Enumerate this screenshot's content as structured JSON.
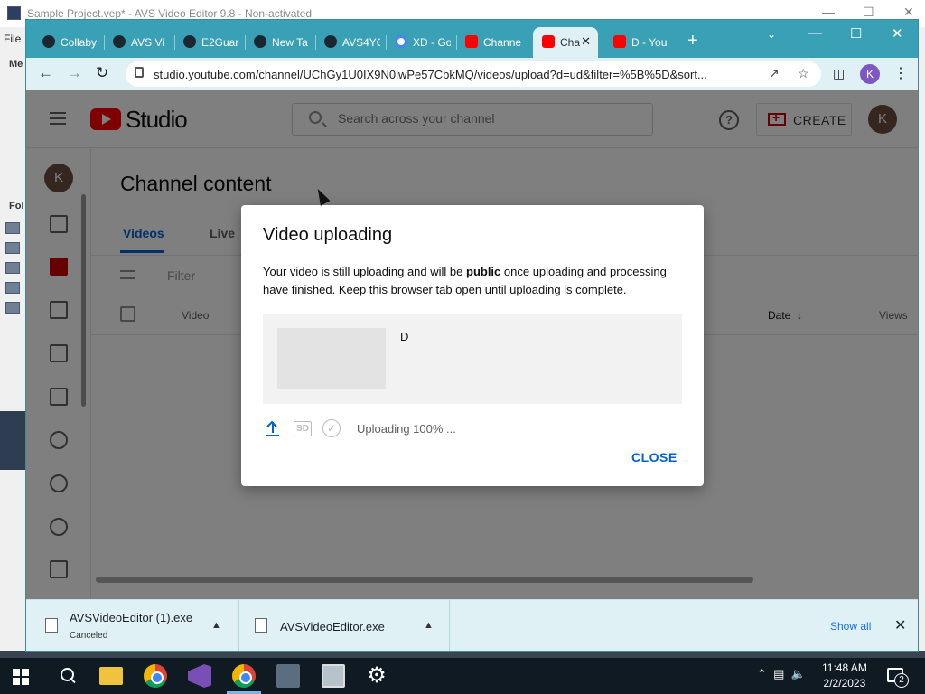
{
  "avs": {
    "title": "Sample Project.vep* - AVS Video Editor 9.8 - Non-activated",
    "menu_file": "File",
    "menu_me": "Me",
    "folders_label": "Fol"
  },
  "browser": {
    "tabs": [
      {
        "label": "Collaby",
        "favicon": "globe-icon"
      },
      {
        "label": "AVS Vi",
        "favicon": "globe-icon"
      },
      {
        "label": "E2Guar",
        "favicon": "globe-icon"
      },
      {
        "label": "New Ta",
        "favicon": "chrome-icon"
      },
      {
        "label": "AVS4YO",
        "favicon": "number-icon"
      },
      {
        "label": "XD - Go",
        "favicon": "google-icon"
      },
      {
        "label": "Channe",
        "favicon": "youtube-icon"
      },
      {
        "label": "Cha",
        "favicon": "youtube-icon",
        "active": true
      },
      {
        "label": "D - You",
        "favicon": "youtube-icon"
      }
    ],
    "url": "studio.youtube.com/channel/UChGy1U0IX9N0lwPe57CbkMQ/videos/upload?d=ud&filter=%5B%5D&sort...",
    "profile_initial": "K"
  },
  "studio": {
    "logo_text": "Studio",
    "search_placeholder": "Search across your channel",
    "create_label": "CREATE",
    "avatar_initial": "K",
    "page_title": "Channel content",
    "tabs": [
      "Videos",
      "Live"
    ],
    "filter_placeholder": "Filter",
    "columns": {
      "video": "Video",
      "date": "Date",
      "views": "Views"
    }
  },
  "dialog": {
    "title": "Video uploading",
    "message_pre": "Your video is still uploading and will be ",
    "message_bold": "public",
    "message_post": " once uploading and processing have finished. Keep this browser tab open until uploading is complete.",
    "video_title": "D",
    "sd_badge": "SD",
    "status": "Uploading 100% ...",
    "close_label": "CLOSE"
  },
  "downloads": {
    "items": [
      {
        "name": "AVSVideoEditor (1).exe",
        "status": "Canceled"
      },
      {
        "name": "AVSVideoEditor.exe",
        "status": ""
      }
    ],
    "show_all": "Show all"
  },
  "taskbar": {
    "time": "11:48 AM",
    "date": "2/2/2023",
    "notification_count": "2"
  },
  "colors": {
    "chrome_teal": "#3aa0b5",
    "youtube_red": "#ff0000",
    "link_blue": "#065fd4"
  }
}
